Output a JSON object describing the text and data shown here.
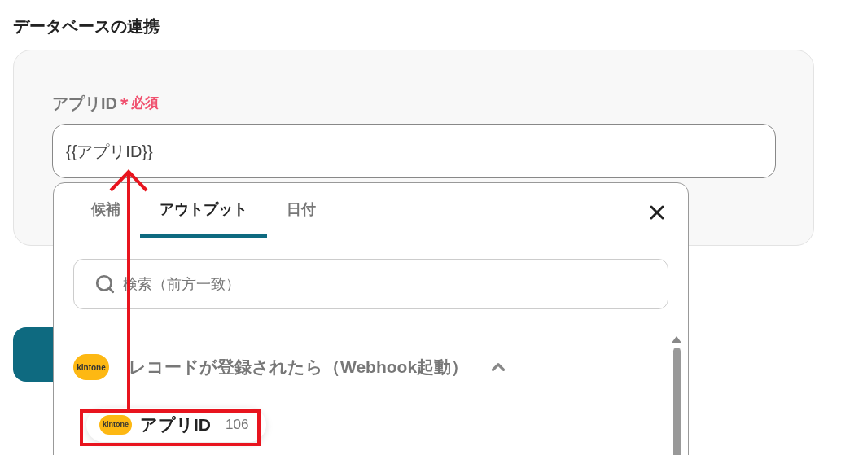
{
  "heading": "データベースの連携",
  "field": {
    "label": "アプリID",
    "required_mark": "*",
    "required_text": "必須",
    "value": "{{アプリID}}"
  },
  "popup": {
    "tabs": [
      {
        "label": "候補",
        "selected": false
      },
      {
        "label": "アウトプット",
        "selected": true
      },
      {
        "label": "日付",
        "selected": false
      }
    ],
    "search": {
      "placeholder": "検索（前方一致）"
    },
    "group": {
      "logo_text": "kintone",
      "title": "レコードが登録されたら（Webhook起動）",
      "expanded": true
    },
    "items": [
      {
        "logo_text": "kintone",
        "label": "アプリID",
        "value": "106"
      }
    ]
  }
}
